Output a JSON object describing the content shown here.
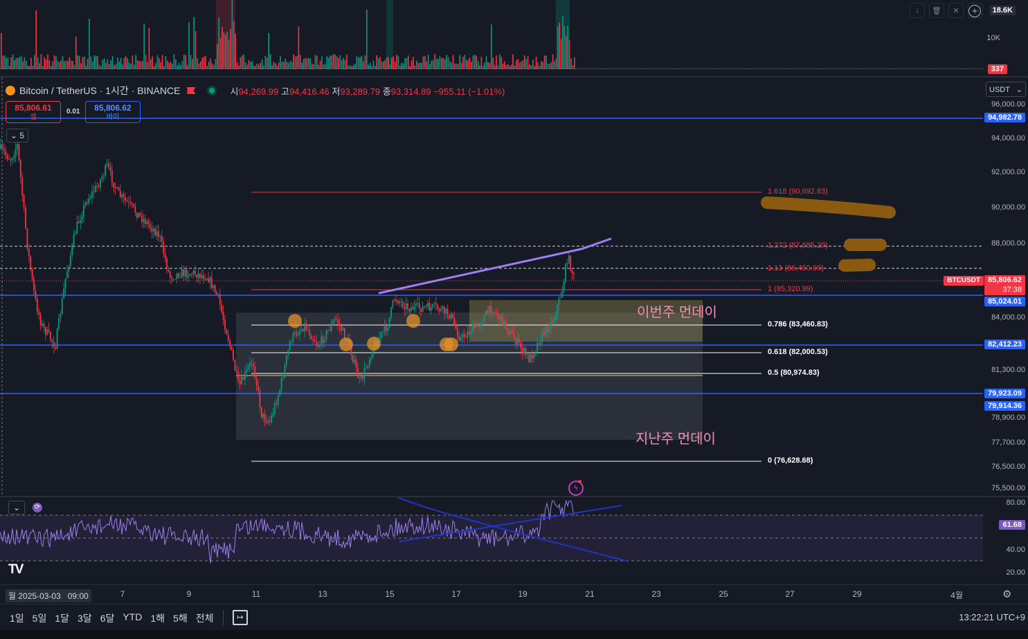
{
  "volume": {
    "labels": [
      "18.6K",
      "10K"
    ],
    "last_value": "337"
  },
  "legend": {
    "title": "Bitcoin / TetherUS · 1시간 · BINANCE",
    "o_label": "시",
    "o": "94,269.99",
    "h_label": "고",
    "h": "94,416.46",
    "l_label": "저",
    "l": "93,289.79",
    "c_label": "종",
    "c": "93,314.89",
    "change": "−955.11 (−1.01%)",
    "currency": "USDT",
    "indicator_count": "5"
  },
  "trade": {
    "sell_price": "85,806.61",
    "sell_label": "셀",
    "spread": "0.01",
    "buy_price": "85,806.62",
    "buy_label": "바이"
  },
  "price_axis": [
    "96,000.00",
    "94,000.00",
    "92,000.00",
    "90,000.00",
    "88,000.00",
    "86,000.00",
    "84,000.00",
    "81,300.00",
    "80,100.00",
    "78,900.00",
    "77,700.00",
    "76,500.00",
    "75,500.00"
  ],
  "price_tags": {
    "level1": "94,982.78",
    "symbol": "BTCUSDT",
    "last": "85,806.62",
    "countdown": "37:38",
    "level2": "85,024.01",
    "level3": "82,412.23",
    "level4": "79,923.09",
    "level5": "79,914.36"
  },
  "fib": [
    {
      "label": "1.618 (90,692.83)"
    },
    {
      "label": "1.272 (87,685.29)"
    },
    {
      "label": "1.13 (86,450.99)"
    },
    {
      "label": "1 (85,320.99)"
    },
    {
      "label": "0.786 (83,460.83)"
    },
    {
      "label": "0.618 (82,000.53)"
    },
    {
      "label": "0.5 (80,974.83)"
    },
    {
      "label": "0 (76,628.68)"
    }
  ],
  "annotations": {
    "this_week": "이번주 먼데이",
    "last_week": "지난주 먼데이"
  },
  "rsi": {
    "axis": [
      "80.00",
      "40.00",
      "20.00"
    ],
    "value": "61.68"
  },
  "dates": [
    "월 2025-03-03   09:00",
    "7",
    "9",
    "11",
    "13",
    "15",
    "17",
    "19",
    "21",
    "23",
    "25",
    "27",
    "29",
    "4월"
  ],
  "timeframes": [
    "1일",
    "5일",
    "1달",
    "3달",
    "6달",
    "YTD",
    "1해",
    "5해",
    "전체"
  ],
  "clock": "13:22:21 UTC+9",
  "colors": {
    "bg": "#161a25",
    "blue": "#2962ff",
    "red": "#f23645",
    "green": "#089981",
    "purple": "#9c7ff0"
  }
}
